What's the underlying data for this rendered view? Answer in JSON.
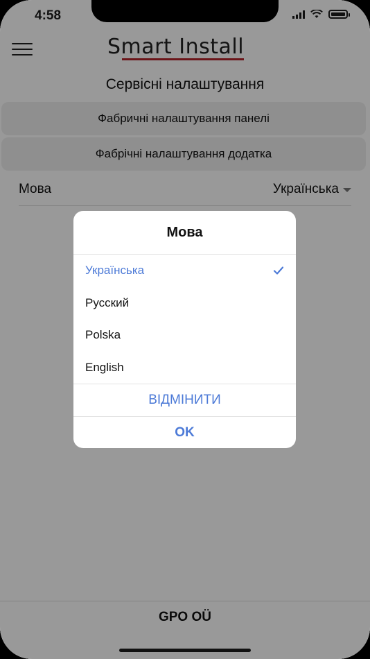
{
  "status_bar": {
    "time": "4:58"
  },
  "header": {
    "logo_text": "Smart Install"
  },
  "page": {
    "title": "Сервісні налаштування",
    "buttons": [
      {
        "label": "Фабричні налаштування панелі"
      },
      {
        "label": "Фабрічні налаштування додатка"
      }
    ],
    "language_row": {
      "label": "Мова",
      "value": "Українська"
    }
  },
  "footer": {
    "text": "GPO OÜ"
  },
  "dialog": {
    "title": "Мова",
    "options": [
      {
        "label": "Українська",
        "selected": true
      },
      {
        "label": "Русский",
        "selected": false
      },
      {
        "label": "Polska",
        "selected": false
      },
      {
        "label": "English",
        "selected": false
      }
    ],
    "cancel_label": "ВІДМІНИТИ",
    "ok_label": "OK"
  },
  "colors": {
    "accent": "#4c7ad7",
    "logo_underline": "#b3242a",
    "overlay": "rgba(0,0,0,0.4)"
  }
}
